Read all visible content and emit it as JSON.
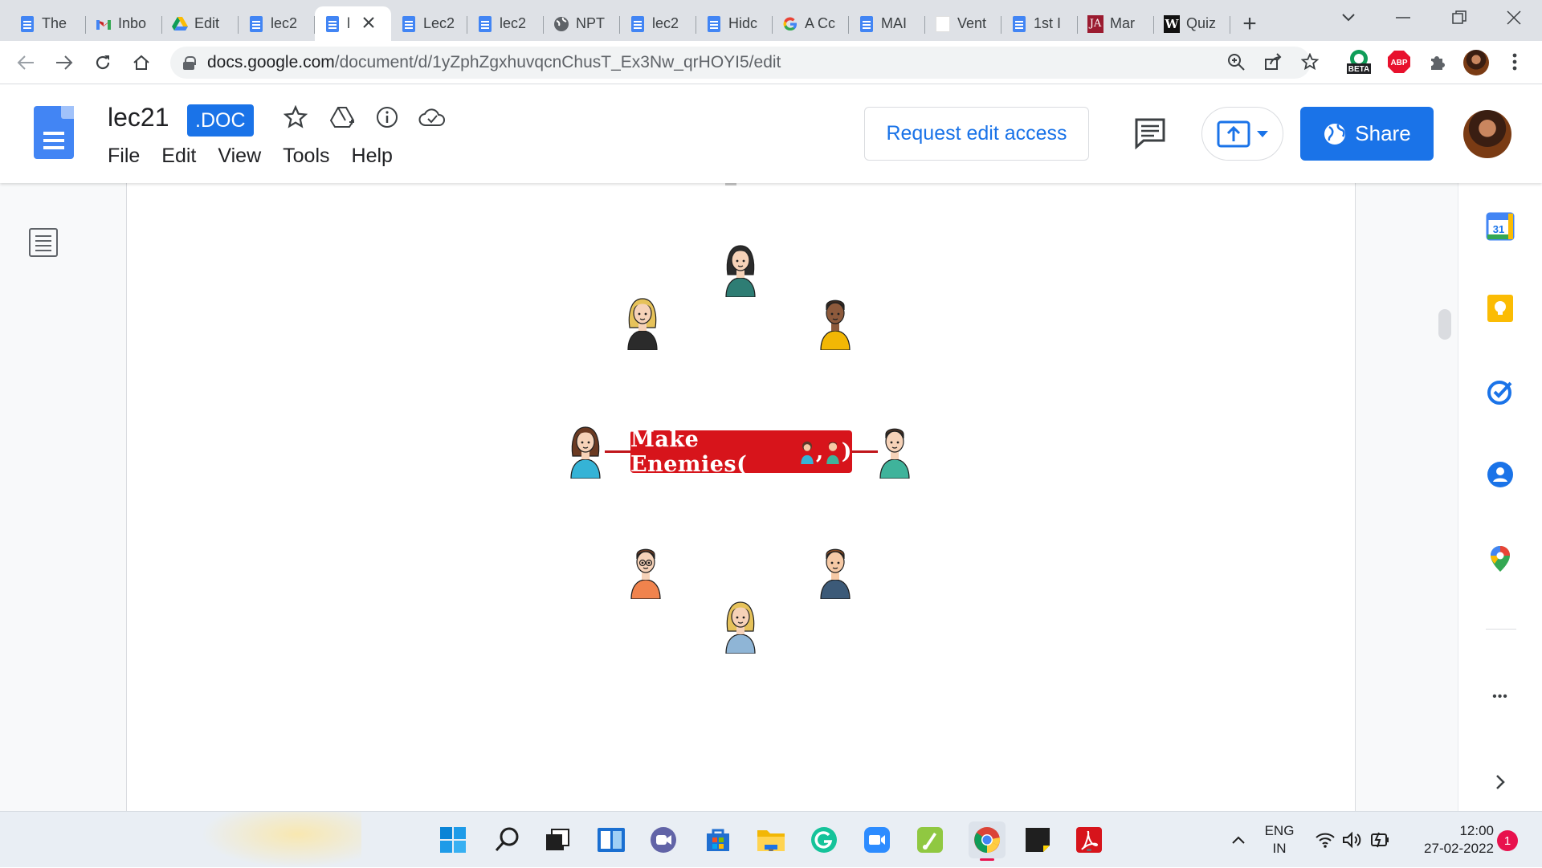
{
  "browser": {
    "tabs": [
      {
        "label": "The",
        "icon": "google-docs-icon",
        "active": false
      },
      {
        "label": "Inbo",
        "icon": "gmail-icon",
        "active": false
      },
      {
        "label": "Edit",
        "icon": "google-drive-icon",
        "active": false
      },
      {
        "label": "lec2",
        "icon": "google-docs-icon",
        "active": false
      },
      {
        "label": "l",
        "icon": "google-docs-icon",
        "active": true
      },
      {
        "label": "Lec2",
        "icon": "google-docs-icon",
        "active": false
      },
      {
        "label": "lec2",
        "icon": "google-docs-icon",
        "active": false
      },
      {
        "label": "NPT",
        "icon": "globe-icon",
        "active": false
      },
      {
        "label": "lec2",
        "icon": "google-docs-icon",
        "active": false
      },
      {
        "label": "Hidc",
        "icon": "google-docs-icon",
        "active": false
      },
      {
        "label": "A Cc",
        "icon": "google-icon",
        "active": false
      },
      {
        "label": "MAI",
        "icon": "google-docs-icon",
        "active": false
      },
      {
        "label": "Vent",
        "icon": "blank-page-icon",
        "active": false
      },
      {
        "label": "1st I",
        "icon": "google-docs-icon",
        "active": false
      },
      {
        "label": "Mar",
        "icon": "ja-icon",
        "active": false
      },
      {
        "label": "Quiz",
        "icon": "w-icon",
        "active": false
      }
    ],
    "url_host": "docs.google.com",
    "url_path": "/document/d/1yZphZgxhuvqcnChusT_Ex3Nw_qrHOYI5/edit",
    "extension_badge": "BETA",
    "abp_label": "ABP"
  },
  "docs": {
    "title": "lec21",
    "badge": ".DOC",
    "menu": [
      "File",
      "Edit",
      "View",
      "Tools",
      "Help"
    ],
    "request_edit": "Request edit access",
    "share": "Share"
  },
  "diagram": {
    "center_label": "Make Enemies(",
    "center_sep": ",",
    "center_close": ")"
  },
  "sidepanel": {
    "calendar_day": "31",
    "more": "•••"
  },
  "taskbar": {
    "lang_top": "ENG",
    "lang_bottom": "IN",
    "time": "12:00",
    "date": "27-02-2022",
    "notifications": "1"
  },
  "colors": {
    "accent": "#1a73e8",
    "node_red": "#d7141b",
    "docs_blue": "#4285f4"
  }
}
